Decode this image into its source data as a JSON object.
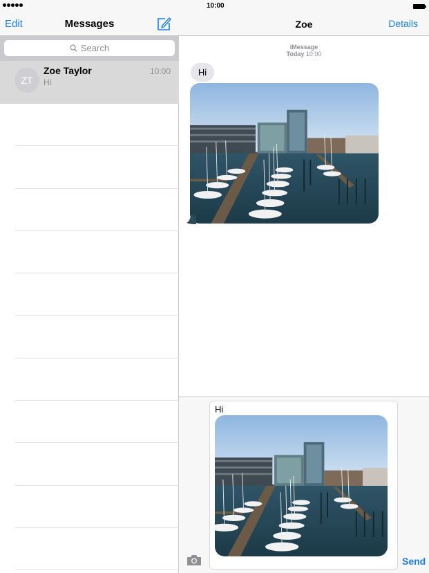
{
  "status": {
    "time": "10:00"
  },
  "left_nav": {
    "edit": "Edit",
    "title": "Messages"
  },
  "search": {
    "placeholder": "Search"
  },
  "conversations": [
    {
      "initials": "ZT",
      "name": "Zoe Taylor",
      "time": "10:00",
      "preview": "Hi"
    }
  ],
  "right_nav": {
    "title": "Zoe",
    "details": "Details"
  },
  "thread": {
    "service": "iMessage",
    "day": "Today",
    "time": "10:00",
    "messages": [
      {
        "type": "text",
        "text": "Hi"
      },
      {
        "type": "image",
        "subject": "marina-photo"
      }
    ]
  },
  "composer": {
    "text": "Hi",
    "send": "Send"
  },
  "colors": {
    "accent": "#157efb",
    "bubble_received": "#e5e5ea",
    "selected_row": "#d9d9d9"
  }
}
